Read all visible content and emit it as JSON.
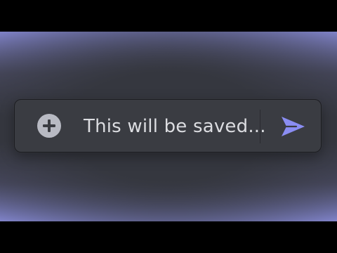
{
  "composer": {
    "add_icon": "plus-circle-icon",
    "message_text": "This will be saved...",
    "send_icon": "send-arrow-icon"
  },
  "colors": {
    "accent": "#8a8df2",
    "composer_background": "#3a3c42",
    "glow": "#7e81c6"
  }
}
